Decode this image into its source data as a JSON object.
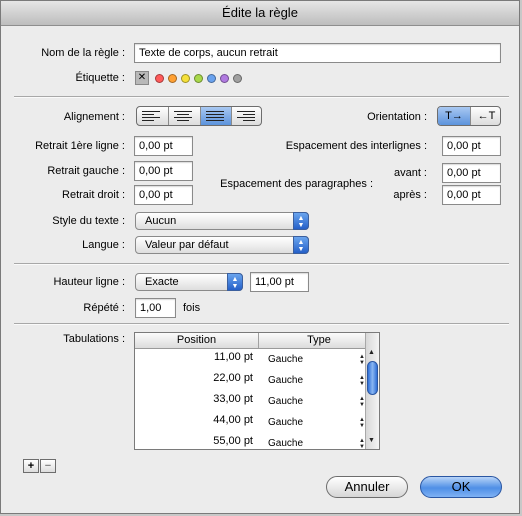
{
  "window": {
    "title": "Édite la règle"
  },
  "rule_name": {
    "label": "Nom de la règle :",
    "value": "Texte de corps, aucun retrait"
  },
  "tag": {
    "label": "Étiquette :",
    "colors": [
      "#ff5a5a",
      "#ffa033",
      "#f5e03a",
      "#a8d84a",
      "#6aa2ee",
      "#b07ae0",
      "#a0a0a0"
    ]
  },
  "alignment": {
    "label": "Alignement :",
    "options": [
      "align-left",
      "align-center",
      "justify",
      "align-right"
    ],
    "selected": "justify"
  },
  "orientation": {
    "label": "Orientation :",
    "options": [
      "T→",
      "←T"
    ],
    "selected": "T→"
  },
  "indents": {
    "first_line": {
      "label": "Retrait 1ère ligne :",
      "value": "0,00 pt"
    },
    "left": {
      "label": "Retrait gauche :",
      "value": "0,00 pt"
    },
    "right": {
      "label": "Retrait droit :",
      "value": "0,00 pt"
    }
  },
  "spacing": {
    "line_label": "Espacement des interlignes :",
    "line_value": "0,00 pt",
    "paragraph_label": "Espacement des paragraphes :",
    "before_label": "avant :",
    "before_value": "0,00 pt",
    "after_label": "après :",
    "after_value": "0,00 pt"
  },
  "text_style": {
    "label": "Style du texte :",
    "value": "Aucun"
  },
  "language": {
    "label": "Langue :",
    "value": "Valeur par défaut"
  },
  "line_height": {
    "label": "Hauteur ligne :",
    "mode": "Exacte",
    "value": "11,00 pt"
  },
  "repeat": {
    "label": "Répété :",
    "value": "1,00",
    "unit": "fois"
  },
  "tabs": {
    "label": "Tabulations :",
    "columns": [
      "Position",
      "Type"
    ],
    "rows": [
      {
        "position": "11,00 pt",
        "type": "Gauche"
      },
      {
        "position": "22,00 pt",
        "type": "Gauche"
      },
      {
        "position": "33,00 pt",
        "type": "Gauche"
      },
      {
        "position": "44,00 pt",
        "type": "Gauche"
      },
      {
        "position": "55,00 pt",
        "type": "Gauche"
      }
    ],
    "add": "+",
    "remove": "−"
  },
  "buttons": {
    "cancel": "Annuler",
    "ok": "OK"
  }
}
